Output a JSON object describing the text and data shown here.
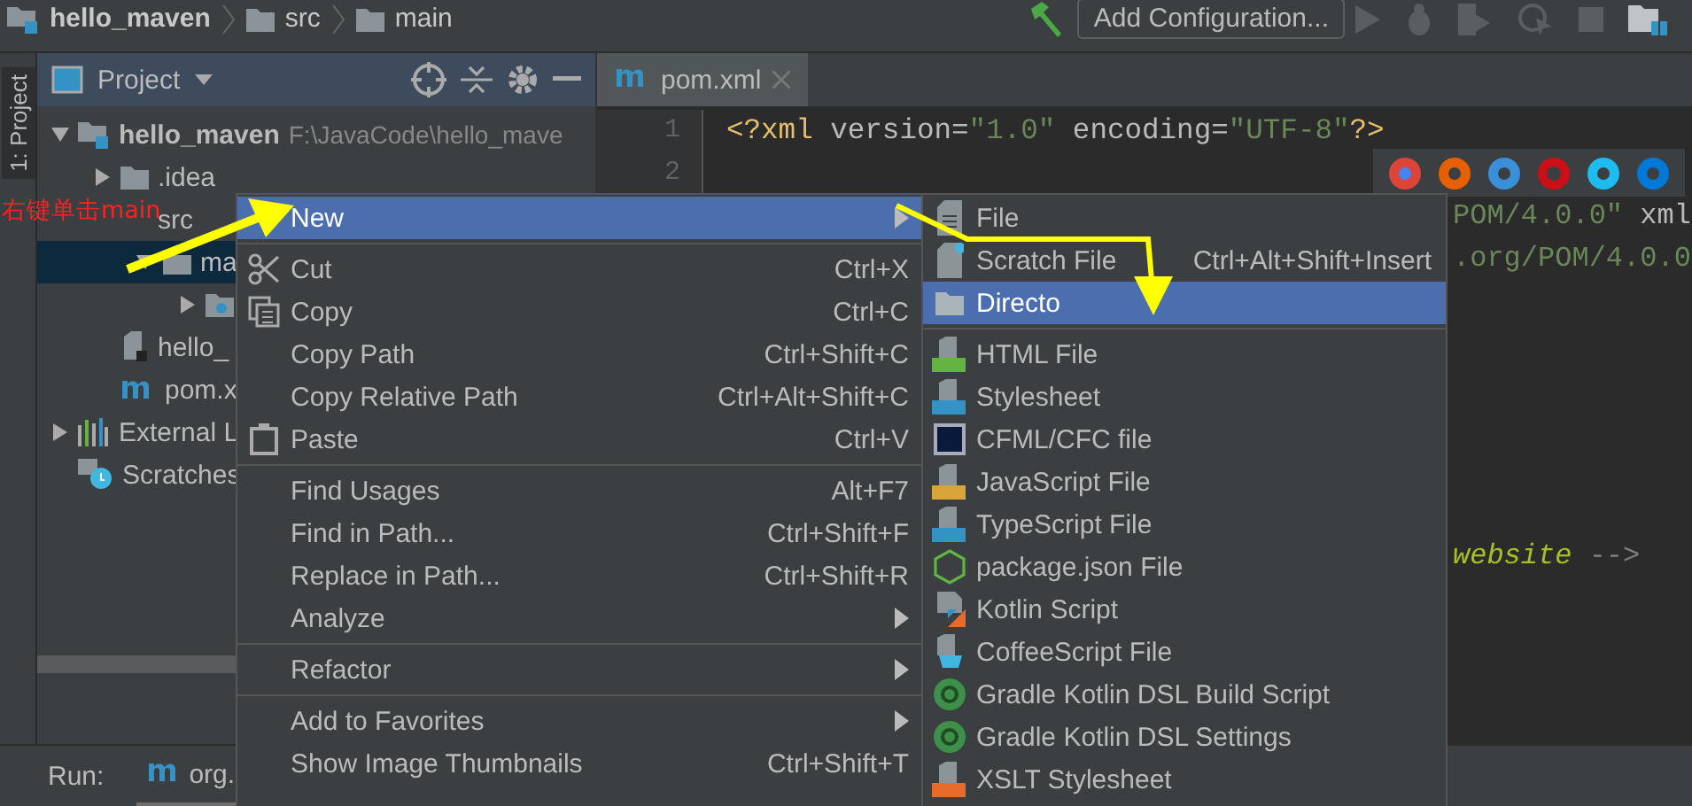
{
  "breadcrumb": [
    {
      "label": "hello_maven",
      "kind": "module"
    },
    {
      "label": "src",
      "kind": "folder"
    },
    {
      "label": "main",
      "kind": "folder"
    }
  ],
  "toolbar": {
    "config_button": "Add Configuration..."
  },
  "side_tab": "1: Project",
  "project_panel": {
    "title": "Project",
    "tree": [
      {
        "label": "hello_maven",
        "detail": "F:\\JavaCode\\hello_mave",
        "kind": "module",
        "expanded": true,
        "selected": false,
        "children": [
          {
            "label": ".idea",
            "kind": "folder",
            "expanded": false,
            "selected": false
          },
          {
            "label": "src",
            "kind": "folder",
            "covered": true,
            "expanded": true,
            "selected": false,
            "children": [
              {
                "label": "ma",
                "kind": "folder",
                "expanded": true,
                "selected": true,
                "children": [
                  {
                    "kind": "resource",
                    "expanded": false,
                    "selected": false
                  }
                ]
              }
            ]
          },
          {
            "label": "hello_",
            "kind": "iml",
            "selected": false
          },
          {
            "label": "pom.x",
            "kind": "maven",
            "selected": false
          }
        ]
      },
      {
        "label": "External L",
        "kind": "library",
        "expanded": false,
        "selected": false
      },
      {
        "label": "Scratches",
        "kind": "scratch",
        "selected": false
      }
    ]
  },
  "editor": {
    "tab": "pom.xml",
    "line_numbers": [
      "1",
      "2"
    ],
    "lines": [
      {
        "kind": "full",
        "segments": [
          {
            "text": "<?xml ",
            "kind": "tag"
          },
          {
            "text": "version=",
            "kind": "attr"
          },
          {
            "text": "\"1.0\" ",
            "kind": "value"
          },
          {
            "text": "encoding=",
            "kind": "attr"
          },
          {
            "text": "\"UTF-8\"",
            "kind": "value"
          },
          {
            "text": "?>",
            "kind": "tag"
          }
        ]
      },
      {
        "kind": "blank"
      },
      {
        "kind": "covered",
        "segments": [
          {
            "text": "POM/4.0.0\" ",
            "kind": "value"
          },
          {
            "text": "xml",
            "kind": "attr"
          }
        ]
      },
      {
        "kind": "covered",
        "segments": [
          {
            "text": ".org/POM/4.0.0",
            "kind": "value"
          }
        ]
      },
      {
        "kind": "blank"
      },
      {
        "kind": "blank"
      },
      {
        "kind": "blank"
      },
      {
        "kind": "blank"
      },
      {
        "kind": "blank"
      },
      {
        "kind": "blank"
      },
      {
        "kind": "covered",
        "segments": [
          {
            "text": "website",
            "kind": "todo"
          },
          {
            "text": " -->",
            "kind": "comment"
          }
        ]
      }
    ]
  },
  "context_menu": {
    "items": [
      {
        "kind": "item",
        "label": "New",
        "submenu": true,
        "selected": true
      },
      {
        "kind": "separator"
      },
      {
        "kind": "item",
        "label": "Cut",
        "shortcut": "Ctrl+X",
        "submenu": false,
        "selected": false
      },
      {
        "kind": "item",
        "label": "Copy",
        "shortcut": "Ctrl+C",
        "submenu": false,
        "selected": false
      },
      {
        "kind": "item",
        "label": "Copy Path",
        "shortcut": "Ctrl+Shift+C",
        "submenu": false,
        "selected": false
      },
      {
        "kind": "item",
        "label": "Copy Relative Path",
        "shortcut": "Ctrl+Alt+Shift+C",
        "submenu": false,
        "selected": false
      },
      {
        "kind": "item",
        "label": "Paste",
        "shortcut": "Ctrl+V",
        "submenu": false,
        "selected": false
      },
      {
        "kind": "separator"
      },
      {
        "kind": "item",
        "label": "Find Usages",
        "shortcut": "Alt+F7",
        "submenu": false,
        "selected": false
      },
      {
        "kind": "item",
        "label": "Find in Path...",
        "shortcut": "Ctrl+Shift+F",
        "submenu": false,
        "selected": false
      },
      {
        "kind": "item",
        "label": "Replace in Path...",
        "shortcut": "Ctrl+Shift+R",
        "submenu": false,
        "selected": false
      },
      {
        "kind": "item",
        "label": "Analyze",
        "submenu": true,
        "selected": false
      },
      {
        "kind": "separator"
      },
      {
        "kind": "item",
        "label": "Refactor",
        "submenu": true,
        "selected": false
      },
      {
        "kind": "separator"
      },
      {
        "kind": "item",
        "label": "Add to Favorites",
        "submenu": true,
        "selected": false
      },
      {
        "kind": "item",
        "label": "Show Image Thumbnails",
        "shortcut": "Ctrl+Shift+T",
        "submenu": false,
        "selected": false
      }
    ]
  },
  "submenu": {
    "items": [
      {
        "kind": "item",
        "label": "File",
        "selected": false
      },
      {
        "kind": "item",
        "label": "Scratch File",
        "shortcut": "Ctrl+Alt+Shift+Insert",
        "selected": false
      },
      {
        "kind": "item",
        "label": "Directo",
        "selected": true
      },
      {
        "kind": "separator"
      },
      {
        "kind": "item",
        "label": "HTML File",
        "selected": false
      },
      {
        "kind": "item",
        "label": "Stylesheet",
        "selected": false
      },
      {
        "kind": "item",
        "label": "CFML/CFC file",
        "selected": false
      },
      {
        "kind": "item",
        "label": "JavaScript File",
        "selected": false
      },
      {
        "kind": "item",
        "label": "TypeScript File",
        "selected": false
      },
      {
        "kind": "item",
        "label": "package.json File",
        "selected": false
      },
      {
        "kind": "item",
        "label": "Kotlin Script",
        "selected": false
      },
      {
        "kind": "item",
        "label": "CoffeeScript File",
        "selected": false
      },
      {
        "kind": "item",
        "label": "Gradle Kotlin DSL Build Script",
        "selected": false
      },
      {
        "kind": "item",
        "label": "Gradle Kotlin DSL Settings",
        "selected": false
      },
      {
        "kind": "item",
        "label": "XSLT Stylesheet",
        "selected": false
      }
    ]
  },
  "run_bar": {
    "label": "Run:",
    "tab": "org."
  },
  "annotation": {
    "text": "右键单击main"
  }
}
